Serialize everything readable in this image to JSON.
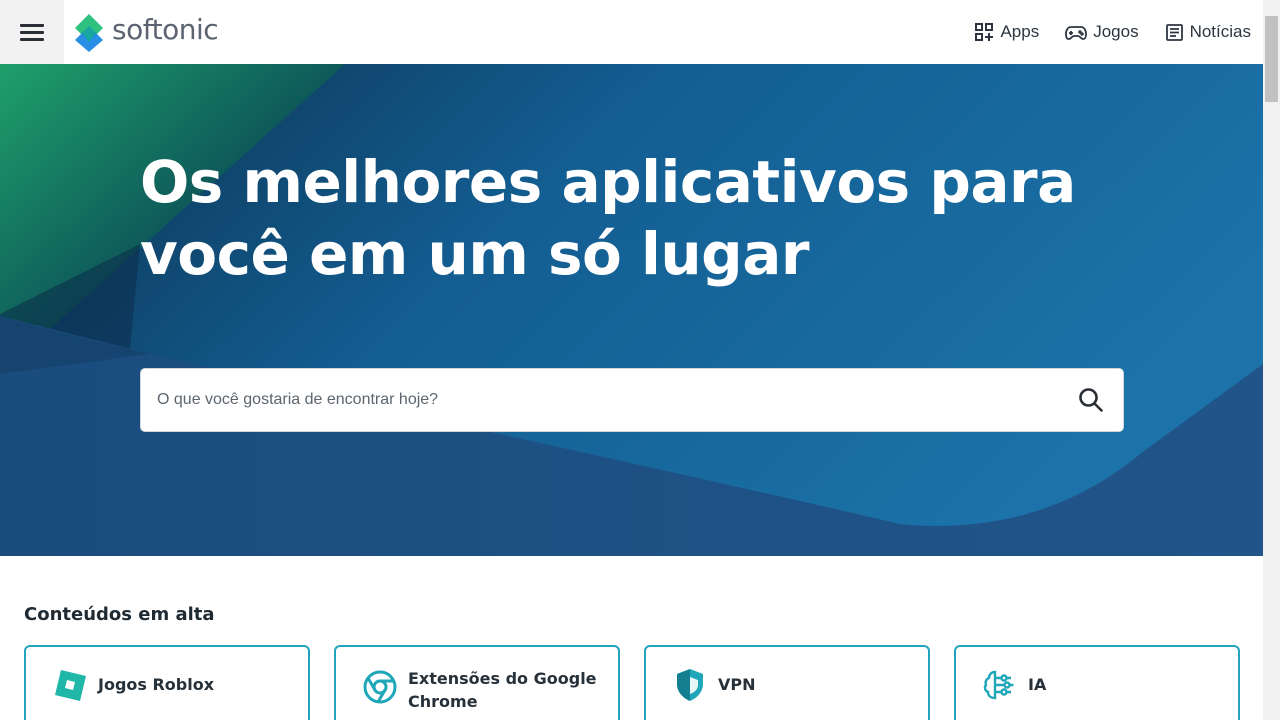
{
  "header": {
    "brand": "softonic",
    "nav": [
      {
        "label": "Apps",
        "icon": "apps-grid-icon"
      },
      {
        "label": "Jogos",
        "icon": "gamepad-icon"
      },
      {
        "label": "Notícias",
        "icon": "news-icon"
      }
    ]
  },
  "hero": {
    "title": "Os melhores aplicativos para você em um só lugar",
    "search_placeholder": "O que você gostaria de encontrar hoje?"
  },
  "trending": {
    "title": "Conteúdos em alta",
    "items": [
      {
        "label": "Jogos Roblox",
        "icon": "roblox-icon"
      },
      {
        "label": "Extensões do Google Chrome",
        "icon": "chrome-icon"
      },
      {
        "label": "VPN",
        "icon": "shield-icon"
      },
      {
        "label": "IA",
        "icon": "ai-brain-icon"
      }
    ]
  },
  "colors": {
    "hero_blue": "#1b6ea4",
    "hero_dark": "#0d3a5c",
    "card_border": "#23a3bd",
    "brand_green": "#2ec27e",
    "brand_blue": "#1e88e5"
  }
}
